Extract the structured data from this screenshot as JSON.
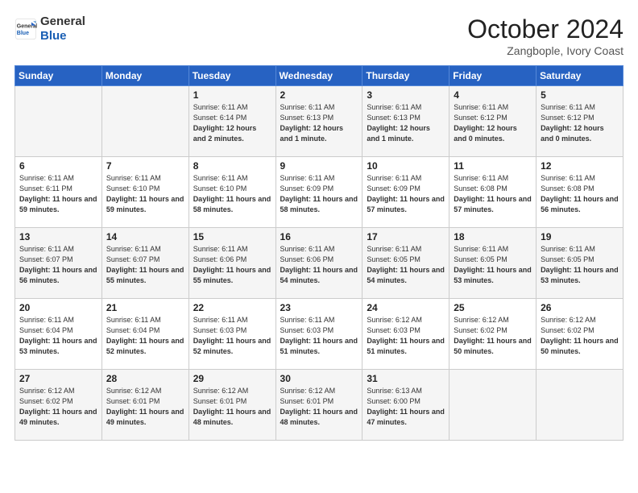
{
  "header": {
    "logo_line1": "General",
    "logo_line2": "Blue",
    "month_title": "October 2024",
    "location": "Zangbople, Ivory Coast"
  },
  "days_of_week": [
    "Sunday",
    "Monday",
    "Tuesday",
    "Wednesday",
    "Thursday",
    "Friday",
    "Saturday"
  ],
  "weeks": [
    [
      {
        "day": "",
        "info": ""
      },
      {
        "day": "",
        "info": ""
      },
      {
        "day": "1",
        "info": "Sunrise: 6:11 AM\nSunset: 6:14 PM\nDaylight: 12 hours and 2 minutes."
      },
      {
        "day": "2",
        "info": "Sunrise: 6:11 AM\nSunset: 6:13 PM\nDaylight: 12 hours and 1 minute."
      },
      {
        "day": "3",
        "info": "Sunrise: 6:11 AM\nSunset: 6:13 PM\nDaylight: 12 hours and 1 minute."
      },
      {
        "day": "4",
        "info": "Sunrise: 6:11 AM\nSunset: 6:12 PM\nDaylight: 12 hours and 0 minutes."
      },
      {
        "day": "5",
        "info": "Sunrise: 6:11 AM\nSunset: 6:12 PM\nDaylight: 12 hours and 0 minutes."
      }
    ],
    [
      {
        "day": "6",
        "info": "Sunrise: 6:11 AM\nSunset: 6:11 PM\nDaylight: 11 hours and 59 minutes."
      },
      {
        "day": "7",
        "info": "Sunrise: 6:11 AM\nSunset: 6:10 PM\nDaylight: 11 hours and 59 minutes."
      },
      {
        "day": "8",
        "info": "Sunrise: 6:11 AM\nSunset: 6:10 PM\nDaylight: 11 hours and 58 minutes."
      },
      {
        "day": "9",
        "info": "Sunrise: 6:11 AM\nSunset: 6:09 PM\nDaylight: 11 hours and 58 minutes."
      },
      {
        "day": "10",
        "info": "Sunrise: 6:11 AM\nSunset: 6:09 PM\nDaylight: 11 hours and 57 minutes."
      },
      {
        "day": "11",
        "info": "Sunrise: 6:11 AM\nSunset: 6:08 PM\nDaylight: 11 hours and 57 minutes."
      },
      {
        "day": "12",
        "info": "Sunrise: 6:11 AM\nSunset: 6:08 PM\nDaylight: 11 hours and 56 minutes."
      }
    ],
    [
      {
        "day": "13",
        "info": "Sunrise: 6:11 AM\nSunset: 6:07 PM\nDaylight: 11 hours and 56 minutes."
      },
      {
        "day": "14",
        "info": "Sunrise: 6:11 AM\nSunset: 6:07 PM\nDaylight: 11 hours and 55 minutes."
      },
      {
        "day": "15",
        "info": "Sunrise: 6:11 AM\nSunset: 6:06 PM\nDaylight: 11 hours and 55 minutes."
      },
      {
        "day": "16",
        "info": "Sunrise: 6:11 AM\nSunset: 6:06 PM\nDaylight: 11 hours and 54 minutes."
      },
      {
        "day": "17",
        "info": "Sunrise: 6:11 AM\nSunset: 6:05 PM\nDaylight: 11 hours and 54 minutes."
      },
      {
        "day": "18",
        "info": "Sunrise: 6:11 AM\nSunset: 6:05 PM\nDaylight: 11 hours and 53 minutes."
      },
      {
        "day": "19",
        "info": "Sunrise: 6:11 AM\nSunset: 6:05 PM\nDaylight: 11 hours and 53 minutes."
      }
    ],
    [
      {
        "day": "20",
        "info": "Sunrise: 6:11 AM\nSunset: 6:04 PM\nDaylight: 11 hours and 53 minutes."
      },
      {
        "day": "21",
        "info": "Sunrise: 6:11 AM\nSunset: 6:04 PM\nDaylight: 11 hours and 52 minutes."
      },
      {
        "day": "22",
        "info": "Sunrise: 6:11 AM\nSunset: 6:03 PM\nDaylight: 11 hours and 52 minutes."
      },
      {
        "day": "23",
        "info": "Sunrise: 6:11 AM\nSunset: 6:03 PM\nDaylight: 11 hours and 51 minutes."
      },
      {
        "day": "24",
        "info": "Sunrise: 6:12 AM\nSunset: 6:03 PM\nDaylight: 11 hours and 51 minutes."
      },
      {
        "day": "25",
        "info": "Sunrise: 6:12 AM\nSunset: 6:02 PM\nDaylight: 11 hours and 50 minutes."
      },
      {
        "day": "26",
        "info": "Sunrise: 6:12 AM\nSunset: 6:02 PM\nDaylight: 11 hours and 50 minutes."
      }
    ],
    [
      {
        "day": "27",
        "info": "Sunrise: 6:12 AM\nSunset: 6:02 PM\nDaylight: 11 hours and 49 minutes."
      },
      {
        "day": "28",
        "info": "Sunrise: 6:12 AM\nSunset: 6:01 PM\nDaylight: 11 hours and 49 minutes."
      },
      {
        "day": "29",
        "info": "Sunrise: 6:12 AM\nSunset: 6:01 PM\nDaylight: 11 hours and 48 minutes."
      },
      {
        "day": "30",
        "info": "Sunrise: 6:12 AM\nSunset: 6:01 PM\nDaylight: 11 hours and 48 minutes."
      },
      {
        "day": "31",
        "info": "Sunrise: 6:13 AM\nSunset: 6:00 PM\nDaylight: 11 hours and 47 minutes."
      },
      {
        "day": "",
        "info": ""
      },
      {
        "day": "",
        "info": ""
      }
    ]
  ]
}
